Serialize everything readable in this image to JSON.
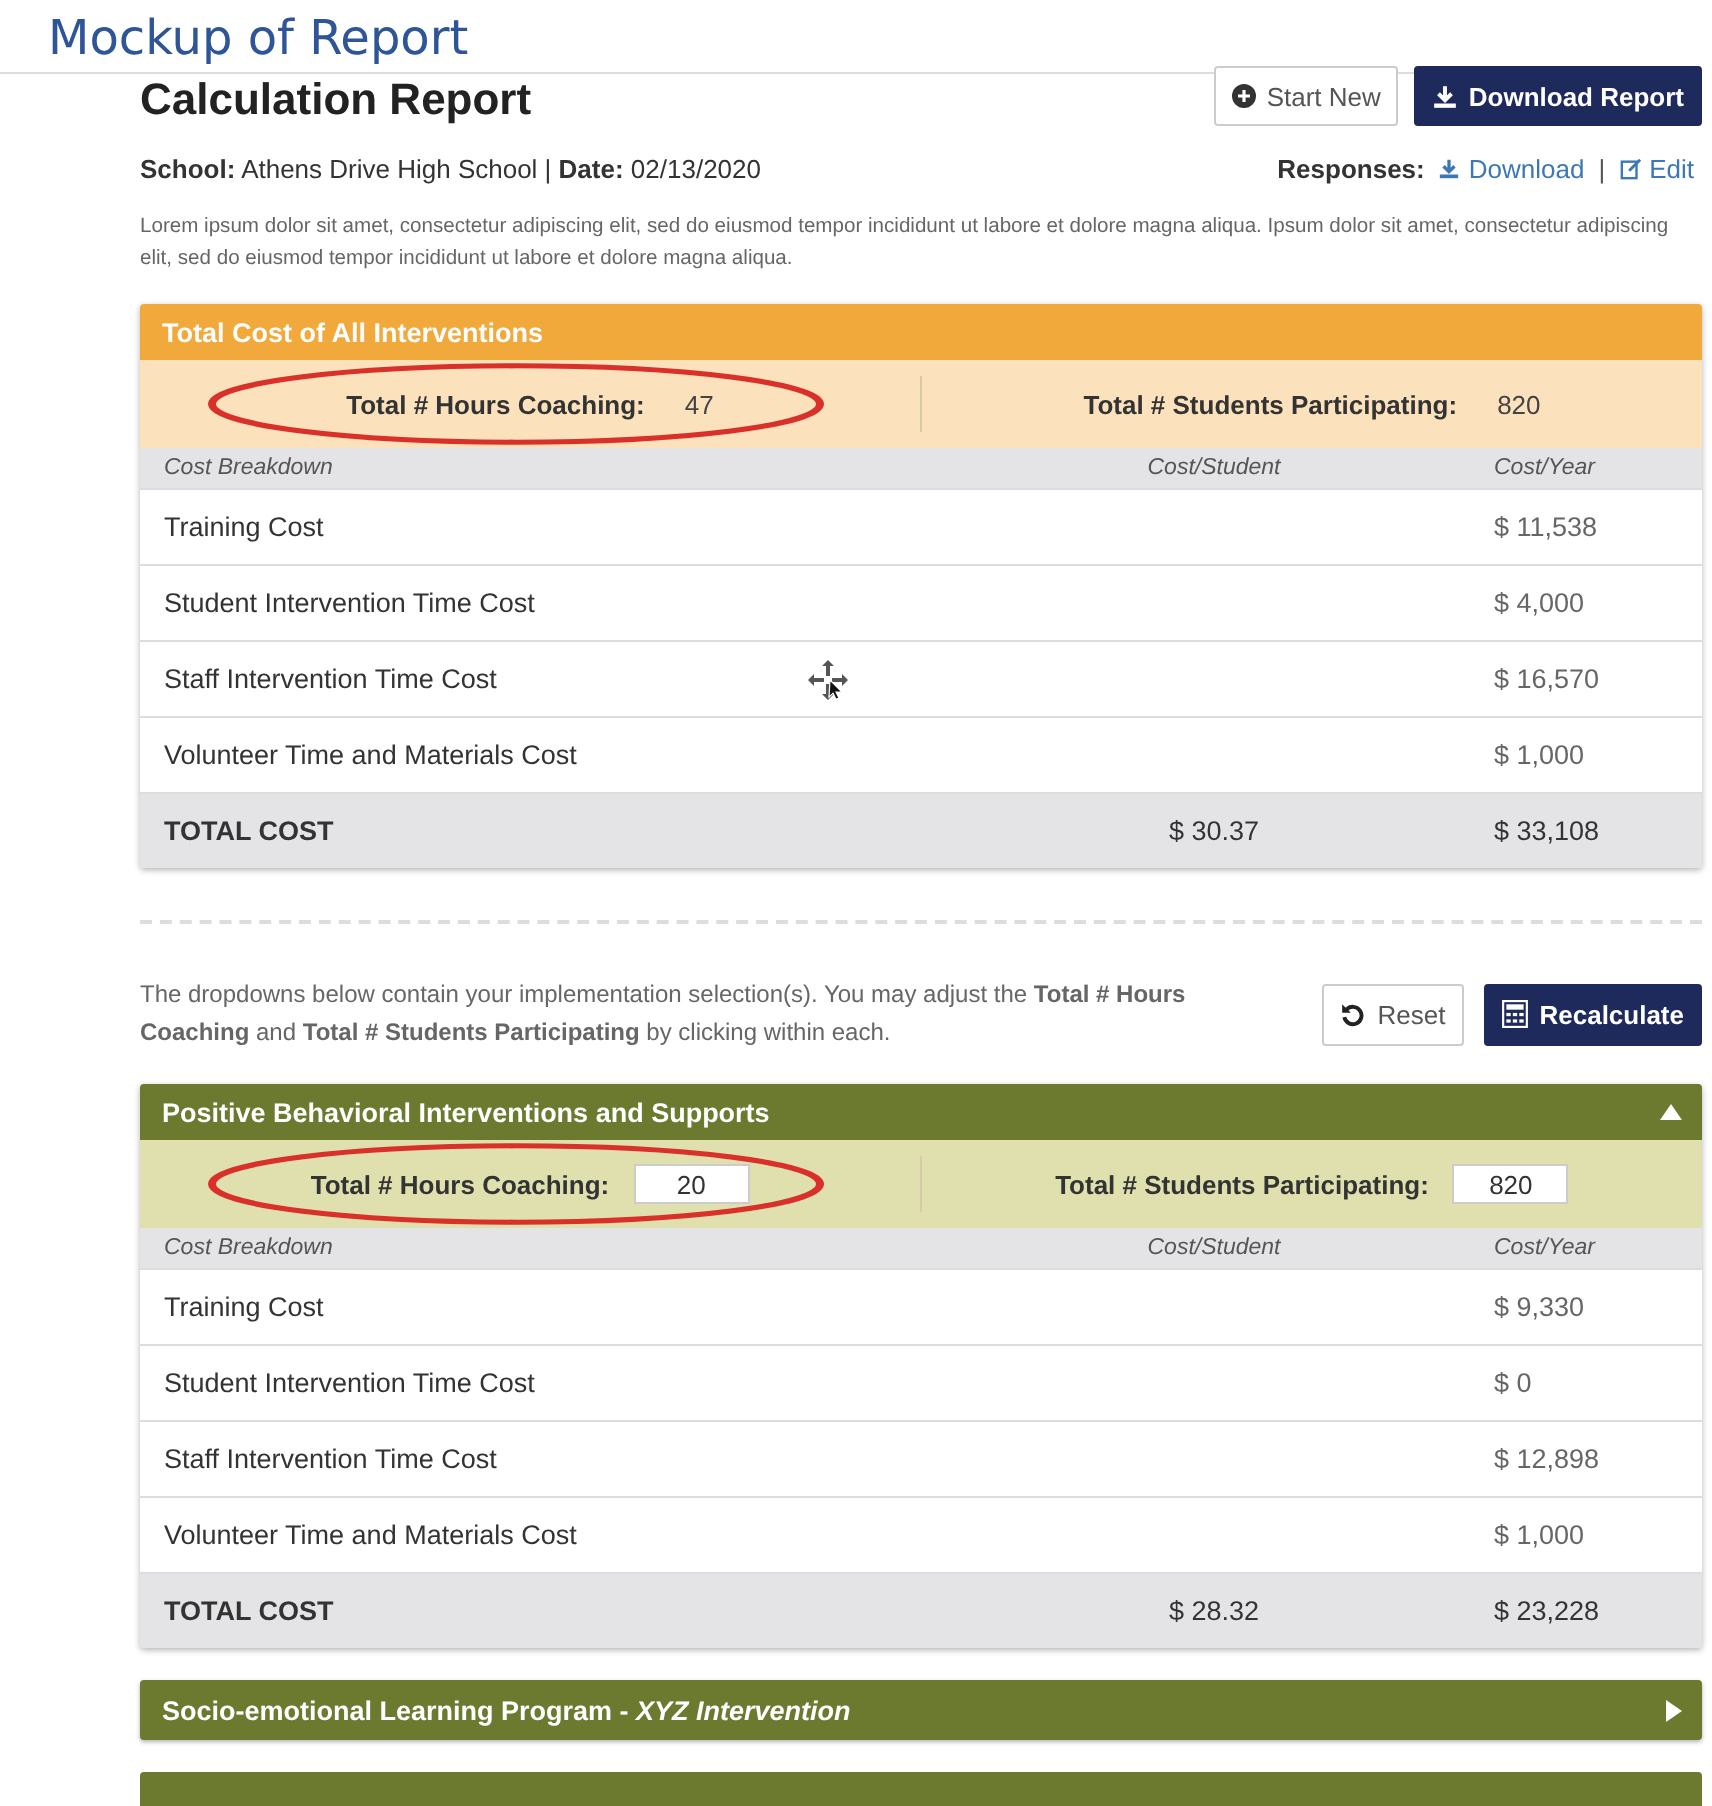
{
  "page_title": "Mockup of Report",
  "report": {
    "title": "Calculation Report",
    "meta": "**School:** Athens Drive High School | **Date:** 02/13/2020"
  },
  "actions": [
    {
      "label": "Start New",
      "kind": "outline"
    },
    {
      "label": "Download Report",
      "kind": "primary"
    }
  ],
  "responses": {
    "label": "Responses:",
    "separator": "|",
    "links": [
      {
        "label": "Download",
        "kind": "download"
      },
      {
        "label": "Edit",
        "kind": "edit"
      }
    ]
  },
  "intro": "Lorem ipsum dolor sit amet, consectetur adipiscing elit, sed do eiusmod tempor incididunt ut labore et dolore magna aliqua. Ipsum dolor sit amet, consectetur adipiscing elit, sed do eiusmod tempor incididunt ut labore et dolore magna aliqua.",
  "instructions": "The dropdowns below contain your implementation selection(s). You may adjust the **Total # Hours Coaching** and **Total # Students Participating** by clicking within each.",
  "tools": [
    {
      "label": "Reset",
      "kind": "reset"
    },
    {
      "label": "Recalculate",
      "kind": "recalculate"
    }
  ],
  "sections": [
    {
      "kind": "total",
      "title": "Total Cost of All Interventions",
      "stats": [
        {
          "label": "Total # Hours Coaching:",
          "value": "47",
          "editable": false,
          "circled": true
        },
        {
          "label": "Total # Students Participating:",
          "value": "820",
          "editable": false,
          "circled": false
        }
      ],
      "columns": [
        "Cost Breakdown",
        "Cost/Student",
        "Cost/Year"
      ],
      "rows": [
        {
          "label": "Training Cost",
          "per_year": "$ 11,538"
        },
        {
          "label": "Student Intervention Time Cost",
          "per_year": "$ 4,000"
        },
        {
          "label": "Staff Intervention Time Cost",
          "per_year": "$ 16,570"
        },
        {
          "label": "Volunteer Time and Materials Cost",
          "per_year": "$ 1,000"
        }
      ],
      "total": {
        "label": "TOTAL COST",
        "per_student": "$ 30.37",
        "per_year": "$ 33,108"
      }
    },
    {
      "kind": "intervention",
      "title": "Positive Behavioral Interventions and Supports",
      "expanded": true,
      "stats": [
        {
          "label": "Total # Hours Coaching:",
          "value": "20",
          "editable": true,
          "circled": true
        },
        {
          "label": "Total # Students Participating:",
          "value": "820",
          "editable": true,
          "circled": false
        }
      ],
      "columns": [
        "Cost Breakdown",
        "Cost/Student",
        "Cost/Year"
      ],
      "rows": [
        {
          "label": "Training Cost",
          "per_year": "$ 9,330"
        },
        {
          "label": "Student Intervention Time Cost",
          "per_year": "$ 0"
        },
        {
          "label": "Staff Intervention Time Cost",
          "per_year": "$ 12,898"
        },
        {
          "label": "Volunteer Time and Materials Cost",
          "per_year": "$ 1,000"
        }
      ],
      "total": {
        "label": "TOTAL COST",
        "per_student": "$ 28.32",
        "per_year": "$ 23,228"
      }
    },
    {
      "kind": "intervention",
      "title": "Socio-emotional Learning Program - *XYZ Intervention*",
      "expanded": false
    }
  ]
}
